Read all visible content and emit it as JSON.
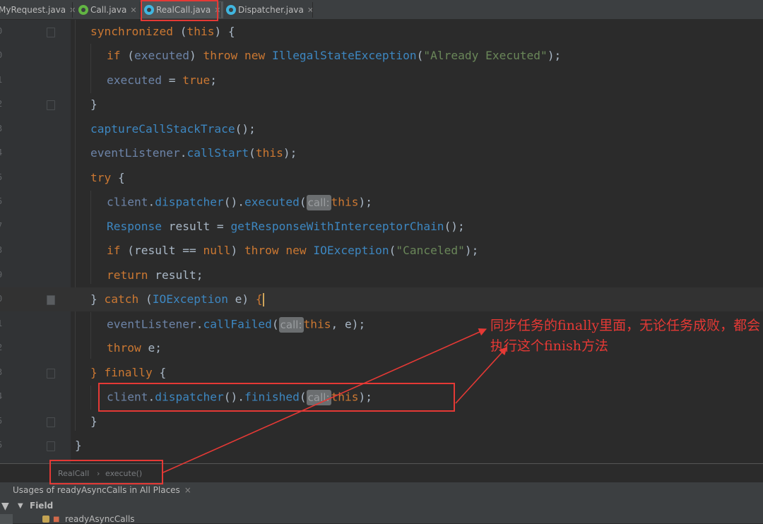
{
  "tabs": [
    {
      "label": "MyRequest.java",
      "icon": "none",
      "active": false
    },
    {
      "label": "Call.java",
      "icon": "interface-icon",
      "active": false
    },
    {
      "label": "RealCall.java",
      "icon": "class-icon",
      "active": true
    },
    {
      "label": "Dispatcher.java",
      "icon": "class-icon",
      "active": false
    }
  ],
  "line_numbers": [
    "0",
    "0",
    "1",
    "2",
    "3",
    "4",
    "5",
    "5",
    "7",
    "3",
    "9",
    "0",
    "1",
    "2",
    "3",
    "4",
    "5",
    "5"
  ],
  "code": {
    "l1": [
      "synchronized",
      " (",
      "this",
      ") {"
    ],
    "l2": [
      "if",
      " (",
      "executed",
      ") ",
      "throw",
      " ",
      "new",
      " ",
      "IllegalStateException",
      "(",
      "\"Already Executed\"",
      ");"
    ],
    "l3": [
      "executed",
      " = ",
      "true",
      ";"
    ],
    "l4": [
      "}"
    ],
    "l5": [
      "captureCallStackTrace",
      "();"
    ],
    "l6": [
      "eventListener",
      ".",
      "callStart",
      "(",
      "this",
      ");"
    ],
    "l7": [
      "try",
      " {"
    ],
    "l8": [
      "client",
      ".",
      "dispatcher",
      "().",
      "executed",
      "(",
      "call:",
      "this",
      ");"
    ],
    "l9": [
      "Response",
      " result = ",
      "getResponseWithInterceptorChain",
      "();"
    ],
    "l10": [
      "if",
      " (result == ",
      "null",
      ") ",
      "throw",
      " ",
      "new",
      " ",
      "IOException",
      "(",
      "\"Canceled\"",
      ");"
    ],
    "l11": [
      "return",
      " result;"
    ],
    "l12": [
      "}",
      " ",
      "catch",
      " (",
      "IOException",
      " e) ",
      "{"
    ],
    "l13": [
      "eventListener",
      ".",
      "callFailed",
      "(",
      "call:",
      "this",
      ", e);"
    ],
    "l14": [
      "throw",
      " e;"
    ],
    "l15": [
      "}",
      " ",
      "finally",
      " {"
    ],
    "l16": [
      "client",
      ".",
      "dispatcher",
      "().",
      "finished",
      "(",
      "call:",
      "this",
      ");"
    ],
    "l17": [
      "}"
    ],
    "l18": [
      "}"
    ]
  },
  "breadcrumb": [
    "RealCall",
    "›",
    "execute()"
  ],
  "usages_panel": {
    "title": "Usages of readyAsyncCalls in All Places",
    "close": "×",
    "group": "Field",
    "item": "readyAsyncCalls"
  },
  "annotation": "同步任务的finally里面，无论任务成败，都会执行这个finish方法",
  "colors": {
    "annotation": "#e53935",
    "editor_bg": "#2b2b2b"
  }
}
